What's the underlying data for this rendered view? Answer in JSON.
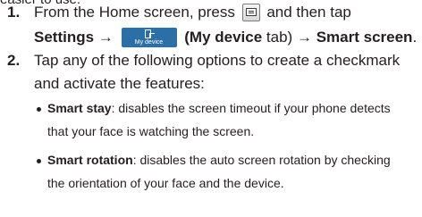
{
  "intro_fragment": "easier to use:",
  "steps": [
    {
      "number": "1.",
      "text_a": "From the Home screen, press",
      "text_b": "and then tap",
      "settings": "Settings",
      "arrow": "→",
      "tab_icon_label": "My device",
      "my_device_tab": "(My device",
      "tab_word": " tab)",
      "smart_screen": "Smart screen",
      "end": "."
    },
    {
      "number": "2.",
      "line1": "Tap any of the following options to create a checkmark",
      "line2": "and activate the features:"
    }
  ],
  "bullets": [
    {
      "term": "Smart stay",
      "line1": ": disables the screen timeout if your phone detects",
      "line2": "that your face is watching the screen."
    },
    {
      "term": "Smart rotation",
      "line1": ": disables the auto screen rotation by checking",
      "line2": "the orientation of your face and the device."
    }
  ]
}
